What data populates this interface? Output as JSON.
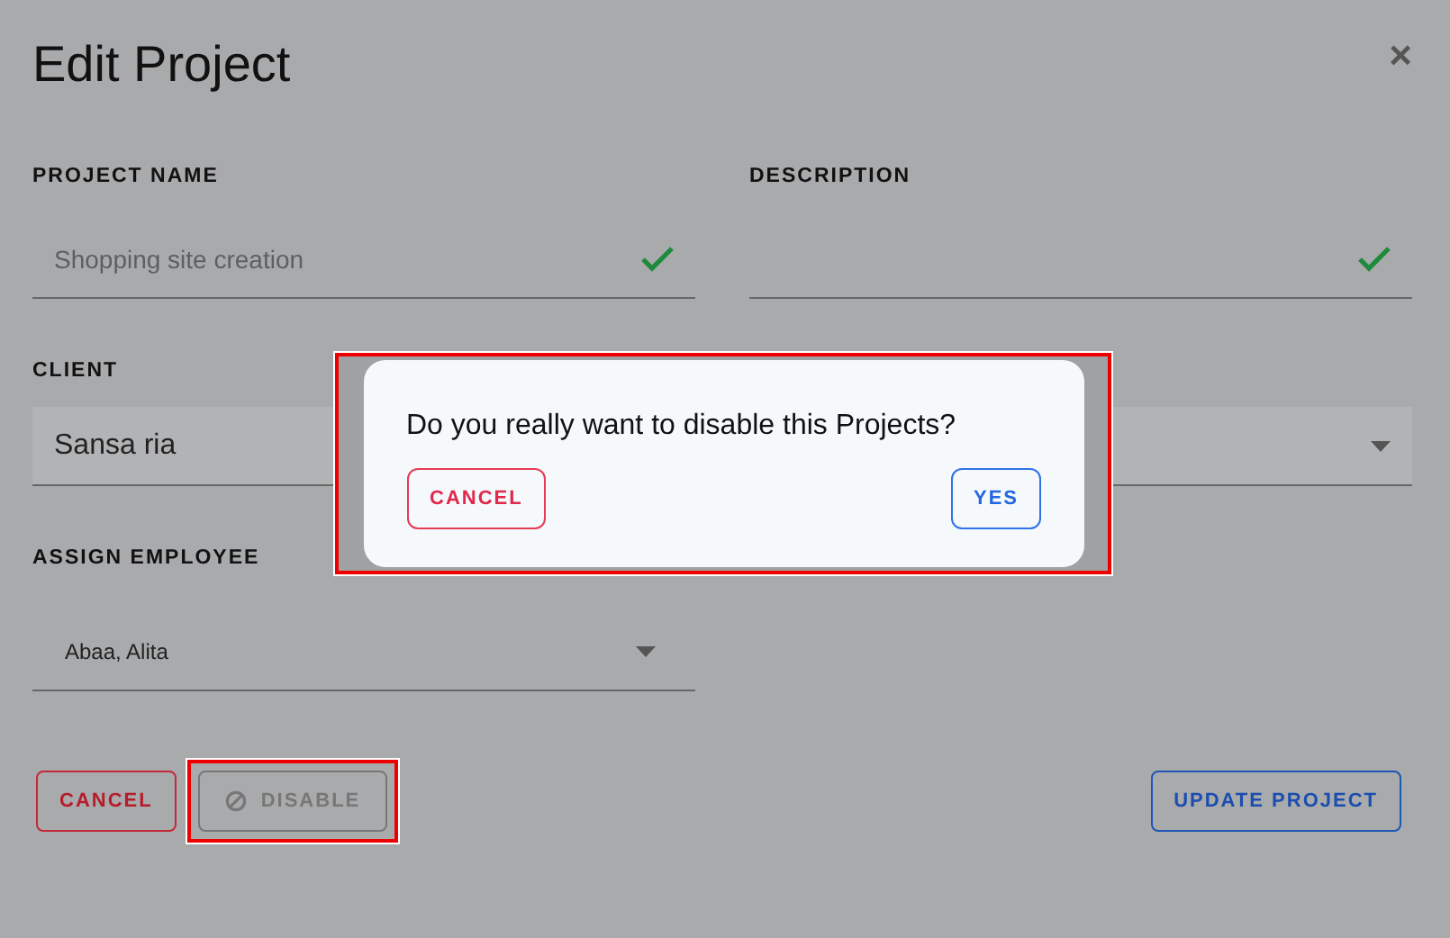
{
  "form": {
    "title": "Edit Project",
    "close": "×",
    "fields": [
      {
        "label": "PROJECT NAME",
        "kind": "text",
        "placeholder": "Shopping site creation",
        "valid": true
      },
      {
        "label": "DESCRIPTION",
        "kind": "text",
        "valid": true
      },
      {
        "label": "CLIENT",
        "kind": "select",
        "value": "Sansa ria",
        "filled": true
      },
      {
        "label": "ASSIGN EMPLOYEE",
        "kind": "select",
        "value": "Abaa, Alita",
        "filled": false
      }
    ],
    "buttons": [
      {
        "label": "CANCEL",
        "kind": "cancel",
        "highlighted": false
      },
      {
        "label": "DISABLE",
        "kind": "disable",
        "highlighted": true
      },
      {
        "label": "UPDATE PROJECT",
        "kind": "update",
        "highlighted": false
      }
    ]
  },
  "dialog": {
    "message": "Do you really want to disable this Projects?",
    "highlighted": true,
    "buttons": [
      {
        "label": "CANCEL",
        "kind": "cancel"
      },
      {
        "label": "YES",
        "kind": "confirm"
      }
    ]
  }
}
